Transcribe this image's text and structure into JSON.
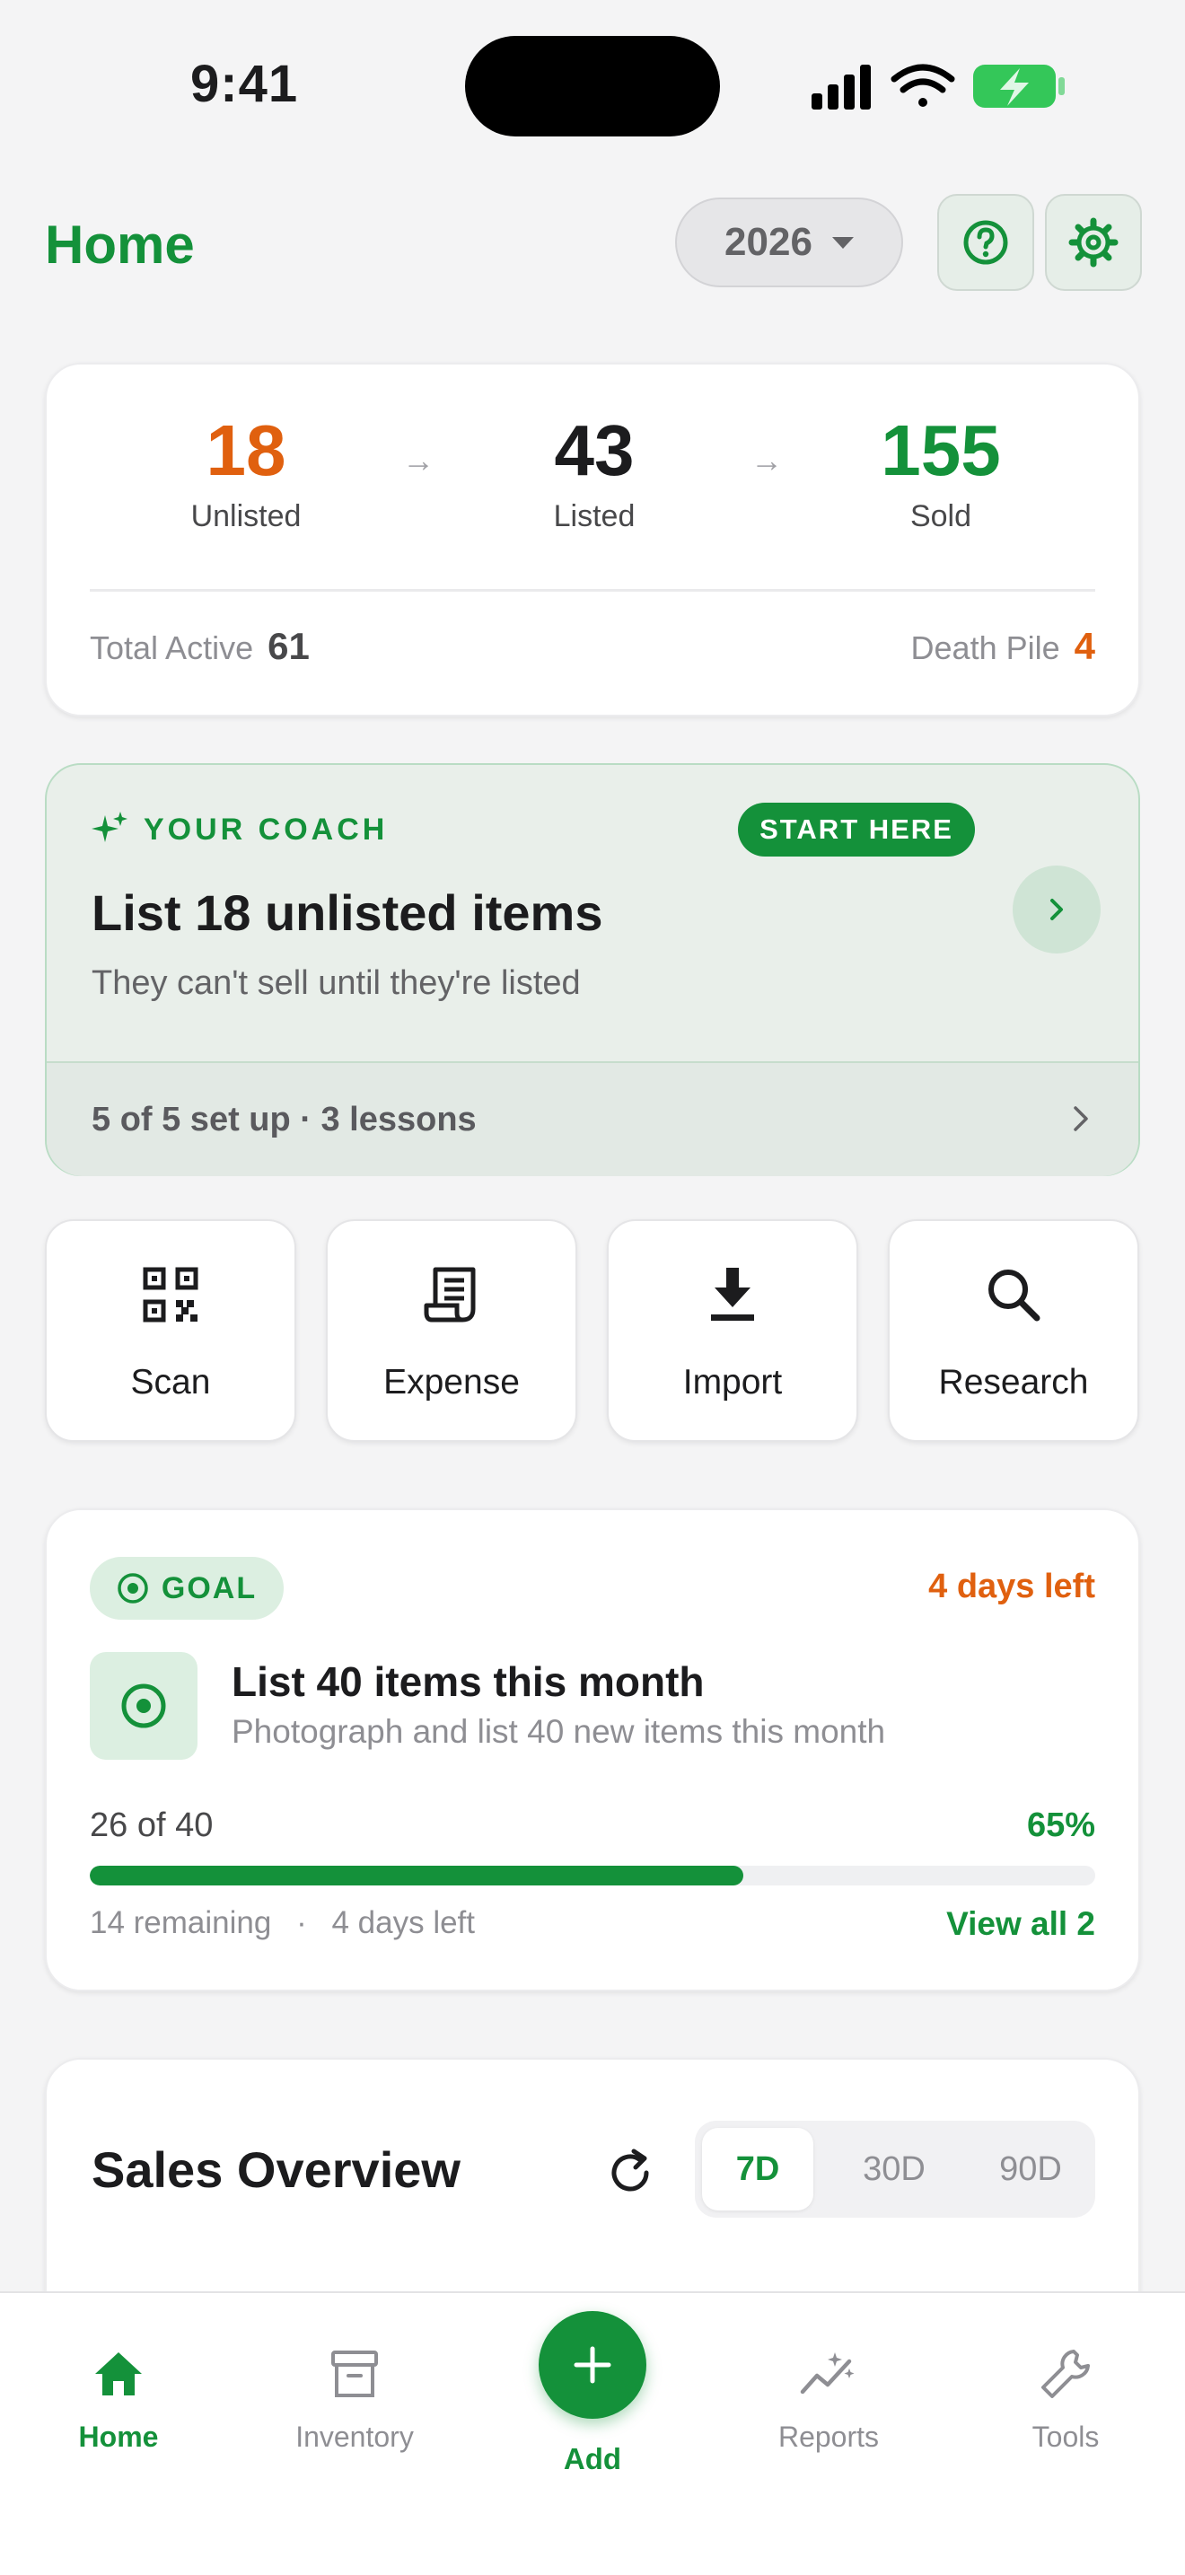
{
  "status_bar": {
    "time": "9:41"
  },
  "header": {
    "title": "Home",
    "year": "2026",
    "help_icon": "question-circle-icon",
    "settings_icon": "gear-icon"
  },
  "summary": {
    "unlisted": {
      "value": "18",
      "label": "Unlisted",
      "color": "#e0600f"
    },
    "listed": {
      "value": "43",
      "label": "Listed",
      "color": "#1c1c1e"
    },
    "sold": {
      "value": "155",
      "label": "Sold",
      "color": "#14913a"
    },
    "total_active_label": "Total Active",
    "total_active_value": "61",
    "death_pile_label": "Death Pile",
    "death_pile_value": "4"
  },
  "coach": {
    "tag": "YOUR COACH",
    "badge": "START HERE",
    "title": "List 18 unlisted items",
    "subtitle": "They can't sell until they're listed",
    "footer": "5 of 5 set up · 3 lessons"
  },
  "quick_actions": [
    {
      "label": "Scan",
      "icon": "qr-scan-icon"
    },
    {
      "label": "Expense",
      "icon": "receipt-icon"
    },
    {
      "label": "Import",
      "icon": "download-icon"
    },
    {
      "label": "Research",
      "icon": "search-icon"
    }
  ],
  "goal": {
    "badge": "GOAL",
    "days_left": "4 days left",
    "title": "List 40 items this month",
    "description": "Photograph and list 40 new items this month",
    "progress_text": "26 of 40",
    "percent_text": "65%",
    "progress_fraction": 0.65,
    "remaining": "14 remaining",
    "separator": "·",
    "footer_days": "4 days left",
    "view_all": "View all 2"
  },
  "sales": {
    "title": "Sales Overview",
    "ranges": [
      "7D",
      "30D",
      "90D"
    ],
    "selected_range": "7D"
  },
  "tabbar": {
    "home": "Home",
    "inventory": "Inventory",
    "add": "Add",
    "reports": "Reports",
    "tools": "Tools"
  },
  "colors": {
    "brand_green": "#14913a",
    "warning_orange": "#e0600f"
  }
}
